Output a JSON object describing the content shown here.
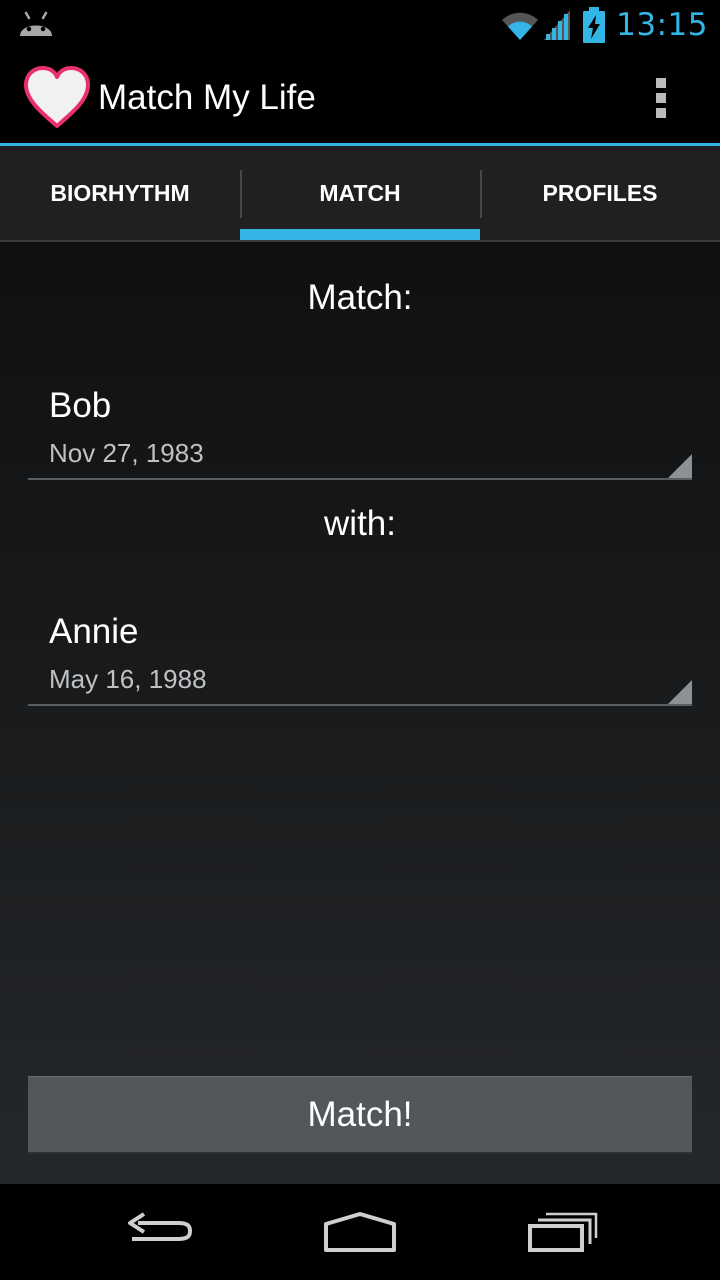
{
  "status_bar": {
    "time": "13:15",
    "icons": [
      "android-notification-icon",
      "wifi-icon",
      "signal-icon",
      "battery-charging-icon"
    ]
  },
  "action_bar": {
    "title": "Match My Life",
    "app_icon": "heart-icon",
    "overflow_icon": "overflow-menu-icon"
  },
  "tabs": [
    {
      "label": "BIORHYTHM",
      "selected": false
    },
    {
      "label": "MATCH",
      "selected": true
    },
    {
      "label": "PROFILES",
      "selected": false
    }
  ],
  "match": {
    "label_match": "Match:",
    "label_with": "with:",
    "person1": {
      "name": "Bob",
      "date": "Nov 27, 1983"
    },
    "person2": {
      "name": "Annie",
      "date": "May 16, 1988"
    },
    "button_label": "Match!"
  },
  "nav_bar": {
    "icons": [
      "back-icon",
      "home-icon",
      "recent-apps-icon"
    ]
  },
  "colors": {
    "accent": "#33b5e5",
    "heart_outline": "#e8306f",
    "button_bg": "#52575b"
  }
}
